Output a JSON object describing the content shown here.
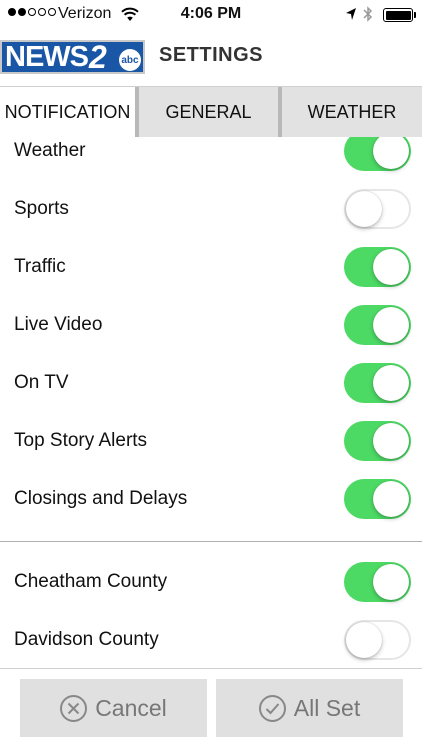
{
  "status_bar": {
    "carrier": "Verizon",
    "time": "4:06 PM",
    "signal_bars_filled": 2,
    "signal_bars_total": 5,
    "battery_level": 1.0
  },
  "header": {
    "logo_news": "NEWS",
    "logo_two": "2",
    "logo_abc": "abc",
    "title": "SETTINGS"
  },
  "tabs": [
    {
      "label": "NOTIFICATION",
      "active": true
    },
    {
      "label": "GENERAL",
      "active": false
    },
    {
      "label": "WEATHER",
      "active": false
    }
  ],
  "notifications": [
    {
      "label": "Weather",
      "on": true
    },
    {
      "label": "Sports",
      "on": false
    },
    {
      "label": "Traffic",
      "on": true
    },
    {
      "label": "Live Video",
      "on": true
    },
    {
      "label": "On TV",
      "on": true
    },
    {
      "label": "Top Story Alerts",
      "on": true
    },
    {
      "label": "Closings and Delays",
      "on": true
    }
  ],
  "counties": [
    {
      "label": "Cheatham County",
      "on": true
    },
    {
      "label": "Davidson County",
      "on": false
    }
  ],
  "footer": {
    "cancel_label": "Cancel",
    "allset_label": "All Set"
  },
  "colors": {
    "toggle_on": "#4cd964",
    "brand_blue": "#1a56a6",
    "button_bg": "#e0e0e0"
  }
}
